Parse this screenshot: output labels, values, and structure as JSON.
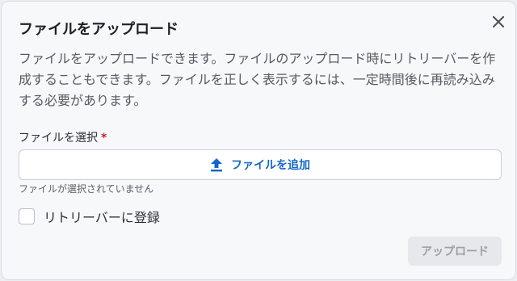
{
  "dialog": {
    "title": "ファイルをアップロード",
    "close_icon": "close-icon",
    "description": "ファイルをアップロードできます。ファイルのアップロード時にリトリーバーを作成することもできます。ファイルを正しく表示するには、一定時間後に再読み込みする必要があります。",
    "file_field": {
      "label": "ファイルを選択",
      "required_mark": "*",
      "add_button_icon": "upload-icon",
      "add_button_label": "ファイルを追加",
      "status": "ファイルが選択されていません"
    },
    "retriever_checkbox": {
      "label": "リトリーバーに登録",
      "checked": false
    },
    "upload_button": {
      "label": "アップロード",
      "disabled": true
    }
  },
  "colors": {
    "accent": "#1466c9",
    "required": "#c8242b",
    "disabled_text": "#9aa0a8"
  }
}
